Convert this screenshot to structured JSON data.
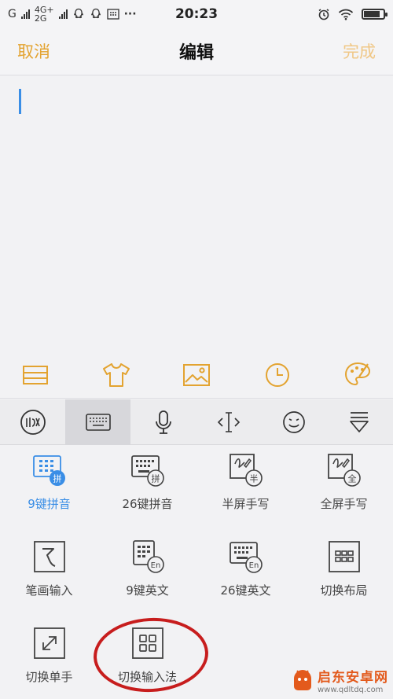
{
  "status_bar": {
    "carrier1": "G",
    "net_top": "4G+",
    "net_bottom": "2G",
    "more": "···",
    "time": "20:23",
    "battery_level": 0.85
  },
  "nav": {
    "cancel_label": "取消",
    "title": "编辑",
    "done_label": "完成"
  },
  "editor": {
    "content": ""
  },
  "toolbar": {
    "icons": [
      "list-icon",
      "tshirt-icon",
      "image-icon",
      "clock-icon",
      "palette-icon"
    ]
  },
  "ime_bar": {
    "icons": [
      "handwriting-logo-icon",
      "keyboard-icon",
      "microphone-icon",
      "cursor-move-icon",
      "emoji-icon",
      "collapse-keyboard-icon"
    ],
    "active_index": 1
  },
  "methods": {
    "items": [
      {
        "label": "9键拼音",
        "badge": "拼",
        "icon": "nine-key-pinyin-icon"
      },
      {
        "label": "26键拼音",
        "badge": "拼",
        "icon": "26-key-pinyin-icon"
      },
      {
        "label": "半屏手写",
        "badge": "半",
        "icon": "half-screen-handwriting-icon"
      },
      {
        "label": "全屏手写",
        "badge": "全",
        "icon": "full-screen-handwriting-icon"
      },
      {
        "label": "笔画输入",
        "badge": "",
        "icon": "stroke-input-icon"
      },
      {
        "label": "9键英文",
        "badge": "En",
        "icon": "nine-key-english-icon"
      },
      {
        "label": "26键英文",
        "badge": "En",
        "icon": "26-key-english-icon"
      },
      {
        "label": "切换布局",
        "badge": "",
        "icon": "switch-layout-icon"
      },
      {
        "label": "切换单手",
        "badge": "",
        "icon": "switch-one-hand-icon"
      },
      {
        "label": "切换输入法",
        "badge": "",
        "icon": "switch-input-method-icon"
      }
    ],
    "selected_index": 0
  },
  "watermark": {
    "name": "启东安卓网",
    "url": "www.qdltdq.com"
  },
  "colors": {
    "accent": "#e3a330",
    "accent_disabled": "#f0c786",
    "selected_blue": "#3a8ee6",
    "highlight_red": "#c71d1d"
  }
}
